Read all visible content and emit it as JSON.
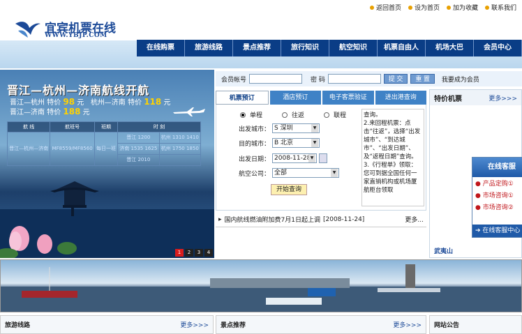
{
  "site": {
    "name_cn": "宜宾机票在线",
    "name_en": "WWW.YBJP.COM"
  },
  "toplinks": [
    "返回首页",
    "设为首页",
    "加为收藏",
    "联系我们"
  ],
  "nav": [
    "在线购票",
    "旅游线路",
    "景点推荐",
    "旅行知识",
    "航空知识",
    "机票自由人",
    "机场大巴",
    "会员中心"
  ],
  "banner": {
    "title": "晋江—杭州—济南航线开航",
    "line1": {
      "a": "晋江—杭州 特价",
      "a_price": "98",
      "a_unit": "元",
      "b": "杭州—济南 特价",
      "b_price": "118",
      "b_unit": "元"
    },
    "line2": {
      "a": "晋江—济南 特价",
      "a_price": "188",
      "a_unit": "元"
    },
    "table": {
      "headers": [
        "航 线",
        "航班号",
        "班期",
        "时 刻"
      ],
      "route": "晋江—杭州—济南",
      "flight": "MF8559/MF8560",
      "schedule": "每日一班",
      "times": [
        "晋江 1200",
        "杭州 1310 1410",
        "济南 1535 1625",
        "杭州 1750 1850",
        "晋江 2010"
      ]
    },
    "pages": [
      "1",
      "2",
      "3",
      "4"
    ]
  },
  "login": {
    "account_label": "会员帐号",
    "password_label": "密 码",
    "submit": "提 交",
    "reset": "重 置",
    "register": "我要成为会员"
  },
  "tabs": [
    "机票预订",
    "酒店预订",
    "电子客票验证",
    "进出港查询"
  ],
  "booking": {
    "trip_types": [
      "单程",
      "往返",
      "联程"
    ],
    "from_label": "出发城市：",
    "from_value": "S 深圳",
    "to_label": "目的城市：",
    "to_value": "B 北京",
    "date_label": "出发日期：",
    "date_value": "2008-11-28",
    "airline_label": "航空公司：",
    "airline_value": "全部",
    "search": "开始查询",
    "notes": "查询。\n2.来回程机票：点击“往返”，选择“出发城市”、“到达城市”、“出发日期”、及“返程日期”查询。\n3.《行程单》领取：您可到据全国任何一家直销机构或机场厦航柜台领取"
  },
  "news": {
    "text": "国内航线燃油附加费7月1日起上调",
    "date": "[2008-11-24]",
    "more": "更多..."
  },
  "special": {
    "title": "特价机票",
    "more": "更多>>>",
    "city": "武夷山"
  },
  "service": {
    "title": "在线客服",
    "items": [
      "产品定购①",
      "市场咨询①",
      "市场咨询②"
    ],
    "center": "在线客服中心"
  },
  "bottom": [
    {
      "title": "旅游线路",
      "more": "更多>>>"
    },
    {
      "title": "景点推荐",
      "more": "更多>>>"
    },
    {
      "title": "网站公告"
    }
  ]
}
